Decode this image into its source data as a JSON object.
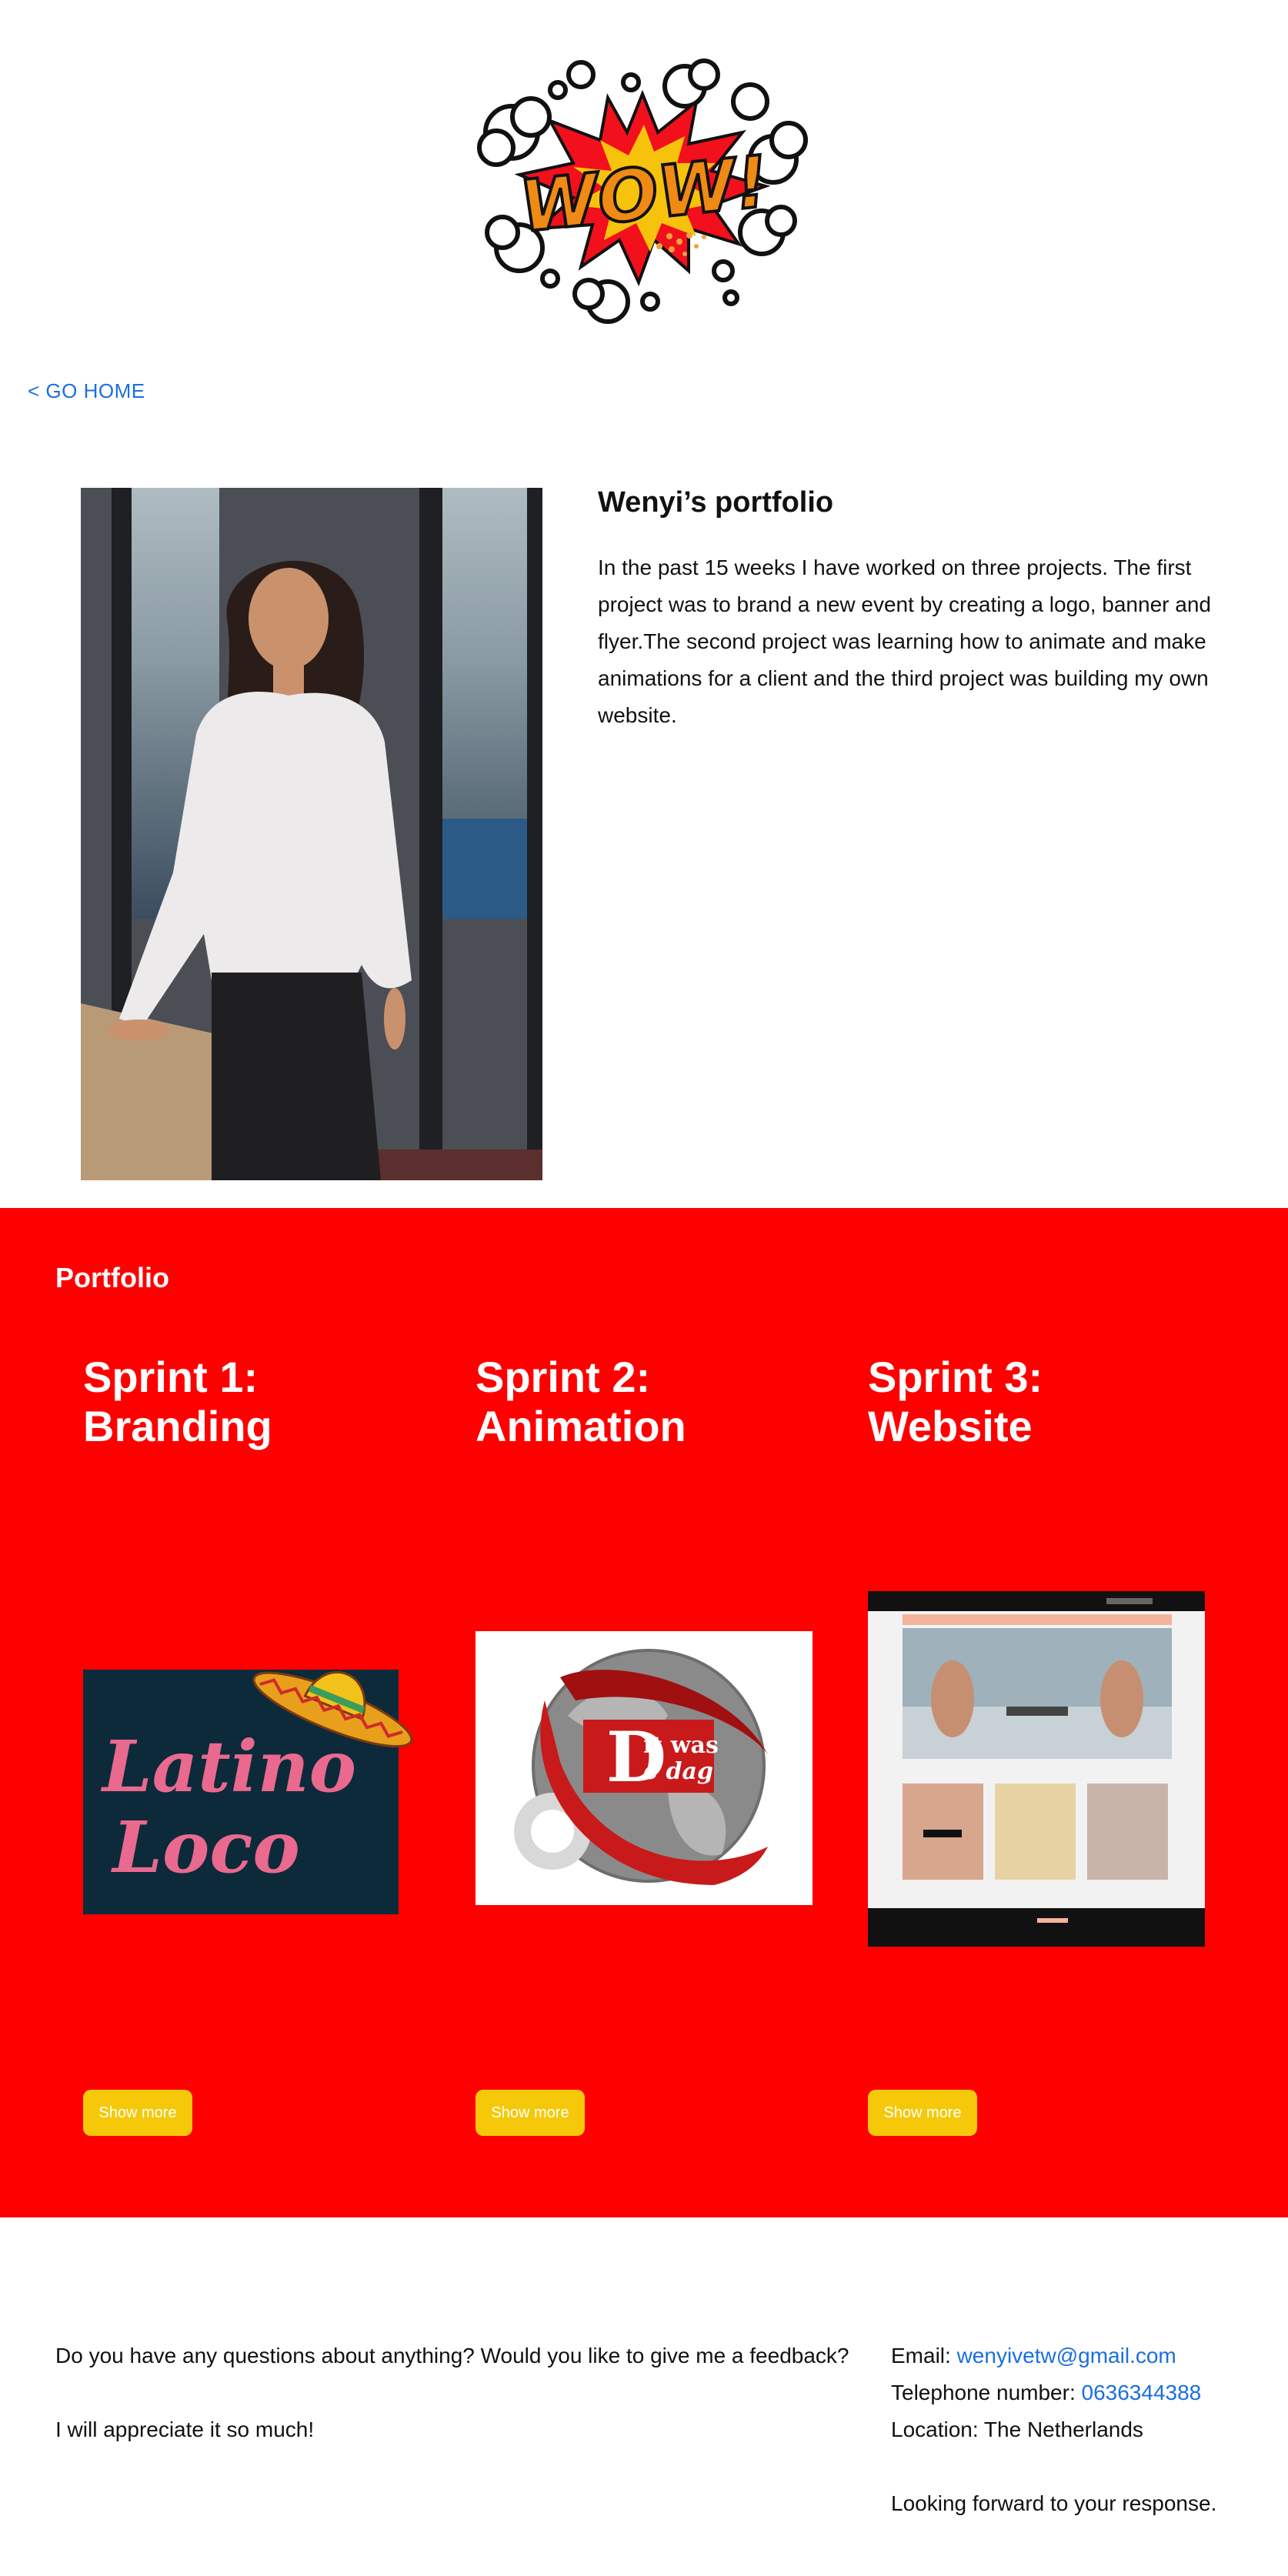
{
  "logo": {
    "text": "WOW!"
  },
  "nav": {
    "go_home": "< GO HOME"
  },
  "intro": {
    "title": "Wenyi’s portfolio",
    "text": "In the past 15 weeks I have worked on three projects. The first project was to brand a new event by creating a logo, banner and flyer.The second project was learning how to animate and make animations for a client and the third project was building my own website."
  },
  "portfolio": {
    "heading": "Portfolio",
    "sprints": [
      {
        "line1": "Sprint 1:",
        "line2": "Branding",
        "button": "Show more",
        "image_text": [
          "Latino",
          "Loco"
        ]
      },
      {
        "line1": "Sprint 2:",
        "line2": "Animation",
        "button": "Show more",
        "image_text": [
          "D",
          "it was",
          "e dag"
        ]
      },
      {
        "line1": "Sprint 3:",
        "line2": "Website",
        "button": "Show more"
      }
    ]
  },
  "footer": {
    "question": "Do you have any questions about anything? Would you like to give me a feedback?",
    "appreciate": "I will appreciate it so much!",
    "email_label": "Email: ",
    "email": "wenyivetw@gmail.com",
    "phone_label": "Telephone number: ",
    "phone": "0636344388",
    "location": "Location: The Netherlands",
    "closing": "Looking forward to your response."
  },
  "colors": {
    "accent_red": "#ff0000",
    "button_yellow": "#f5c90a",
    "link_blue": "#1a6fe0"
  }
}
